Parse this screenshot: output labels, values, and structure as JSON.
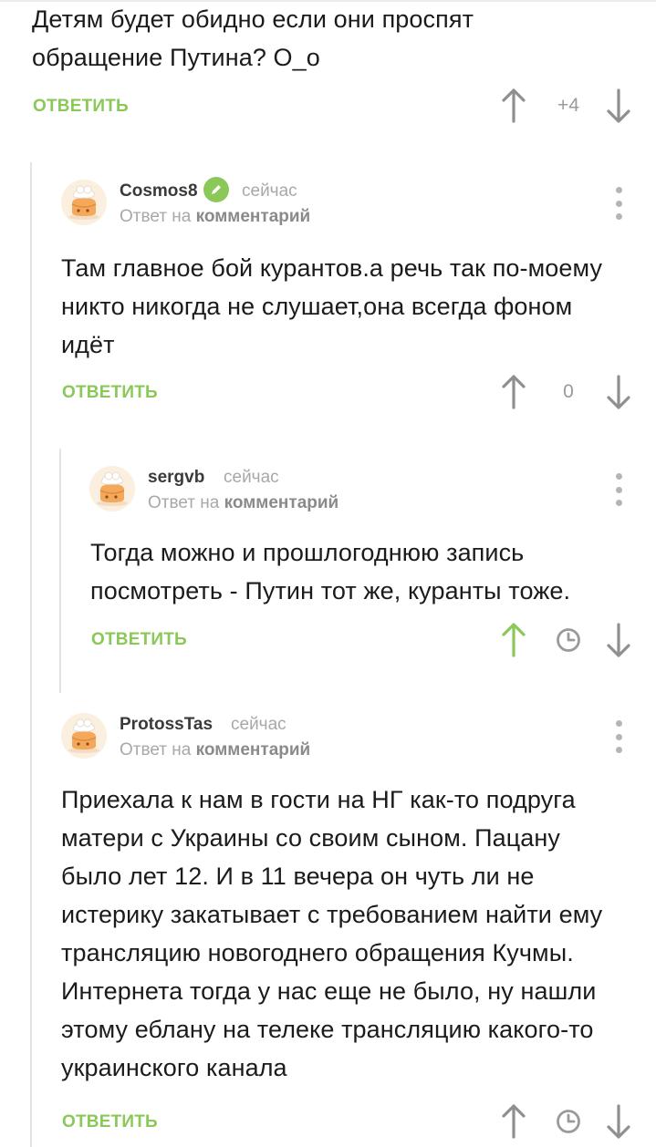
{
  "comments": [
    {
      "text_lines": [
        "Детям будет обидно если они проспят",
        "обращение Путина? О_о"
      ],
      "reply_label": "ОТВЕТИТЬ",
      "rating": "+4"
    },
    {
      "author": "Cosmos8",
      "time": "сейчас",
      "reply_to_prefix": "Ответ на",
      "reply_to_target": "комментарий",
      "text_lines": [
        "Там главное бой курантов.а речь так по-моему",
        "никто никогда не слушает,она всегда фоном",
        "идёт"
      ],
      "reply_label": "ОТВЕТИТЬ",
      "rating": "0",
      "icons": [
        "avatar-cake-icon",
        "verified-pencil-icon",
        "more-vertical-icon",
        "arrow-up-icon",
        "arrow-down-icon"
      ]
    },
    {
      "author": "sergvb",
      "time": "сейчас",
      "reply_to_prefix": "Ответ на",
      "reply_to_target": "комментарий",
      "text_lines": [
        "Тогда можно и прошлогоднюю запись",
        "посмотреть - Путин тот же, куранты тоже."
      ],
      "reply_label": "ОТВЕТИТЬ",
      "icons": [
        "avatar-cake-icon",
        "more-vertical-icon",
        "arrow-up-active-icon",
        "clock-icon",
        "arrow-down-icon"
      ]
    },
    {
      "author": "ProtossTas",
      "time": "сейчас",
      "reply_to_prefix": "Ответ на",
      "reply_to_target": "комментарий",
      "text_lines": [
        "Приехала к нам в гости на НГ как-то подруга",
        "матери с Украины со своим сыном. Пацану",
        "было лет 12. И в 11 вечера он чуть ли не",
        "истерику закатывает с требованием найти ему",
        "трансляцию новогоднего обращения Кучмы.",
        "Интернета тогда у нас еще не было, ну нашли",
        "этому еблану на телеке трансляцию какого-то",
        "украинского канала"
      ],
      "reply_label": "ОТВЕТИТЬ",
      "icons": [
        "avatar-cake-icon",
        "more-vertical-icon",
        "arrow-up-icon",
        "clock-icon",
        "arrow-down-icon"
      ]
    }
  ],
  "colors": {
    "accent": "#8ac858",
    "muted": "#a8a8a8",
    "icon": "#8f8f8f",
    "text": "#1b1b1b"
  }
}
